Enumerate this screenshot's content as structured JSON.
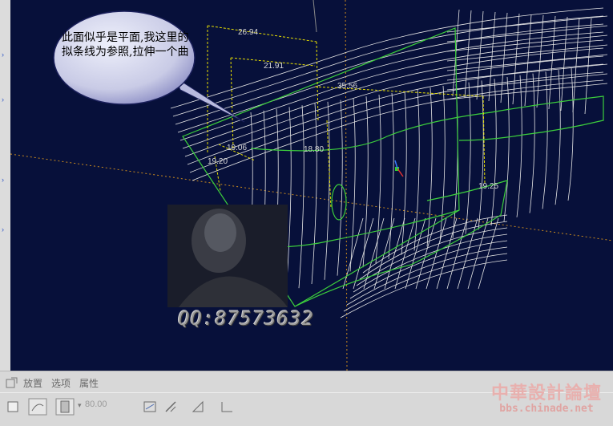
{
  "viewport": {
    "callout_text": "此面似乎是平面,我这里的拟条线为参照,拉伸一个曲",
    "dimensions": [
      "26.94",
      "21.91",
      "35.56",
      "19.06",
      "18.80",
      "19.20",
      "19.25"
    ],
    "watermark_qq": "QQ:87573632"
  },
  "dashboard": {
    "tabs": [
      "放置",
      "选项",
      "属性"
    ],
    "depth_value": "80.00"
  },
  "site_watermark": {
    "name": "中華設計論壇",
    "url": "bbs.chinade.net"
  },
  "colors": {
    "viewport_bg": "#07103a",
    "mesh": "#e6e6e6",
    "sketch": "#3ccf3c",
    "dimension": "#e8e000",
    "callout_fill": "#c9cbe6"
  },
  "icons": [
    "sketch-icon",
    "surface-icon",
    "depth-icon",
    "flip-icon",
    "solid-icon",
    "remove-material-icon",
    "thicken-icon",
    "pause-icon"
  ]
}
